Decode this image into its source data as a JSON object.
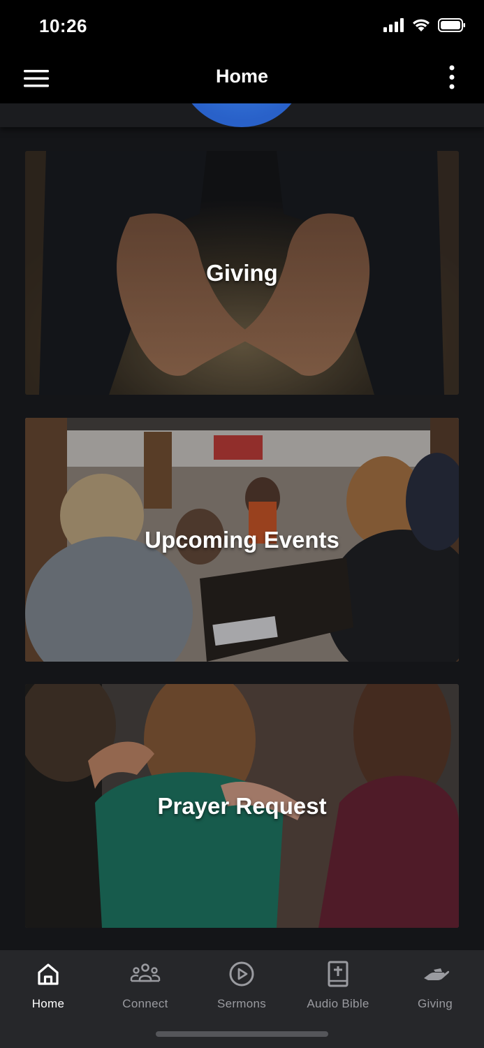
{
  "status_bar": {
    "time": "10:26"
  },
  "nav": {
    "title": "Home"
  },
  "cards": [
    {
      "label": "Giving"
    },
    {
      "label": "Upcoming Events"
    },
    {
      "label": "Prayer Request"
    }
  ],
  "tabs": [
    {
      "label": "Home",
      "icon": "home-icon",
      "active": true
    },
    {
      "label": "Connect",
      "icon": "people-icon",
      "active": false
    },
    {
      "label": "Sermons",
      "icon": "play-circle-icon",
      "active": false
    },
    {
      "label": "Audio Bible",
      "icon": "bible-icon",
      "active": false
    },
    {
      "label": "Giving",
      "icon": "giving-hand-icon",
      "active": false
    }
  ],
  "colors": {
    "accent_logo": "#2f6bd6",
    "tab_active": "#ffffff",
    "tab_inactive": "#9a9ba0"
  }
}
